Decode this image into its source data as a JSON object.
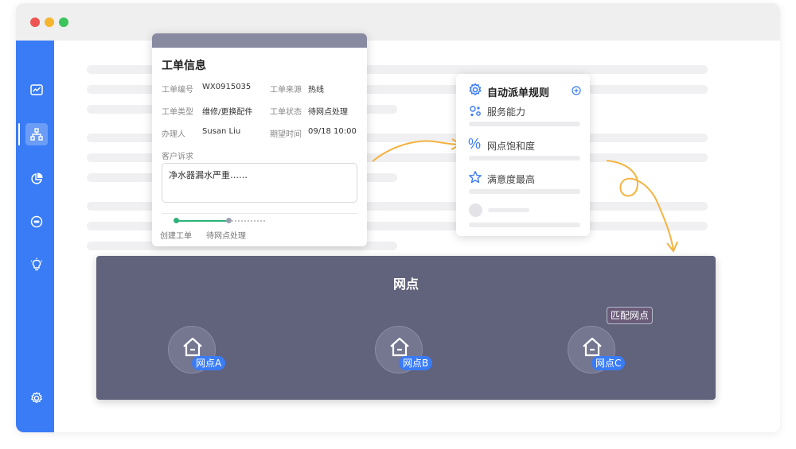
{
  "window": {
    "controls": [
      "close",
      "minimize",
      "maximize"
    ]
  },
  "sidebar": {
    "items": [
      {
        "icon": "chart-icon"
      },
      {
        "icon": "network-icon",
        "active": true
      },
      {
        "icon": "pie-chart-icon"
      },
      {
        "icon": "bug-icon"
      },
      {
        "icon": "lightbulb-icon"
      }
    ],
    "footer_icon": "gear-icon",
    "accent_color": "#3a7cf5"
  },
  "work_order": {
    "title": "工单信息",
    "fields": {
      "number_label": "工单编号",
      "number_value": "WX0915035",
      "source_label": "工单来源",
      "source_value": "热线",
      "type_label": "工单类型",
      "type_value": "维修/更换配件",
      "status_label": "工单状态",
      "status_value": "待网点处理",
      "handler_label": "办理人",
      "handler_value": "Susan Liu",
      "expected_label": "期望时间",
      "expected_value": "09/18 10:00"
    },
    "complaint_label": "客户诉求",
    "complaint_value": "净水器漏水严重……",
    "steps": [
      "创建工单",
      "待网点处理"
    ],
    "step_color_done": "#2db37a"
  },
  "rules": {
    "title": "自动派单规则",
    "items": [
      {
        "icon": "service-capacity-icon",
        "label": "服务能力"
      },
      {
        "icon": "percent-icon",
        "label": "网点饱和度"
      },
      {
        "icon": "star-icon",
        "label": "满意度最高"
      }
    ],
    "icon_color": "#3a7cf5"
  },
  "outlets": {
    "title": "网点",
    "match_label": "匹配网点",
    "nodes": [
      "网点A",
      "网点B",
      "网点C"
    ],
    "panel_color": "#61627c"
  },
  "flow_color": "#f5b342"
}
